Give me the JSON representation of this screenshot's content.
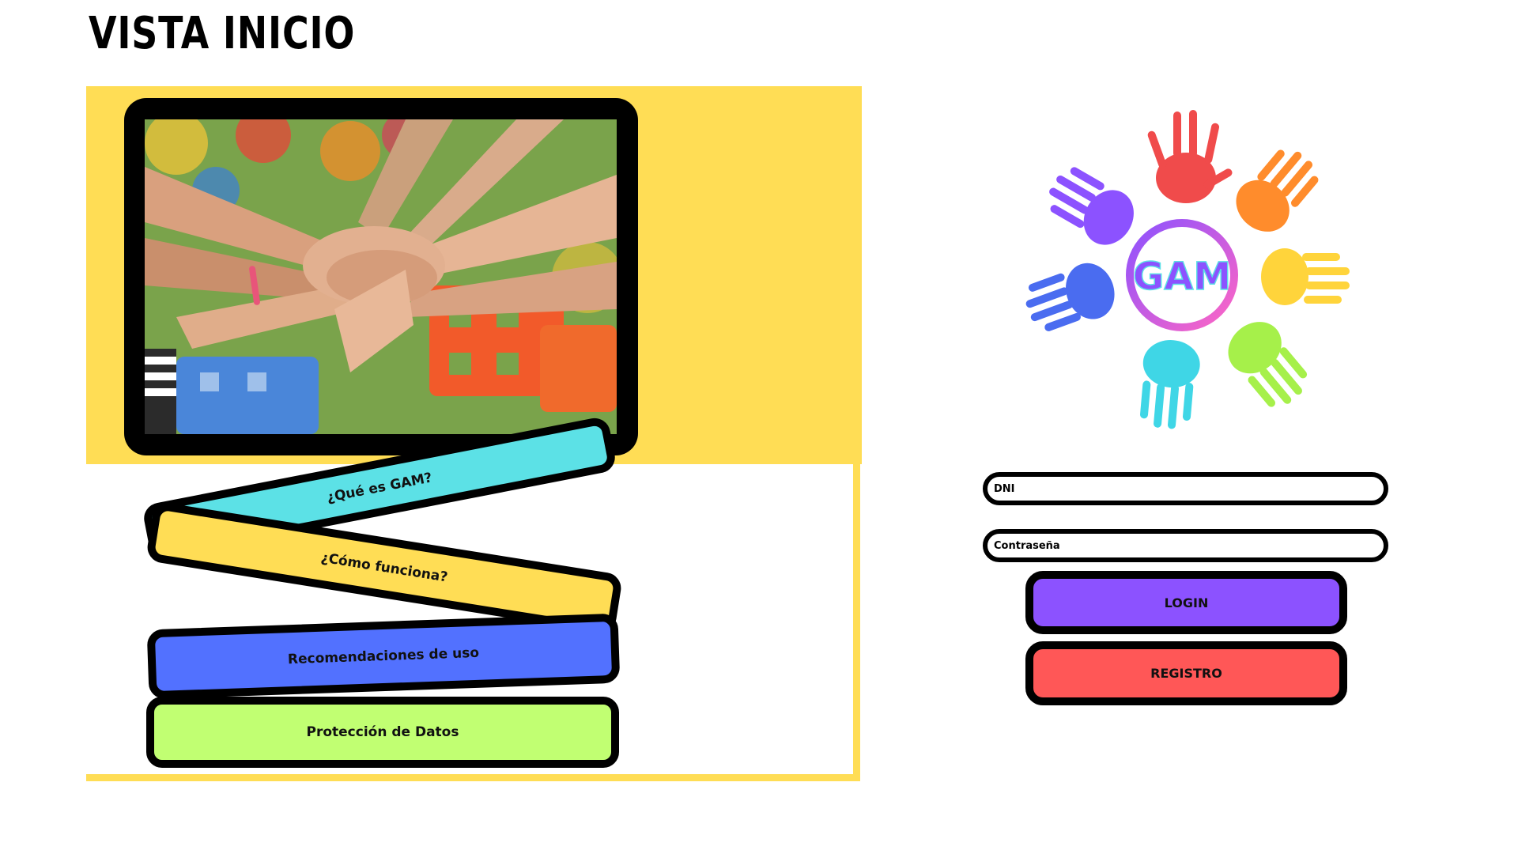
{
  "page": {
    "title": "VISTA INICIO"
  },
  "menu": {
    "items": [
      {
        "label": "¿Qué es GAM?",
        "color": "#5ce1e6"
      },
      {
        "label": "¿Cómo funciona?",
        "color": "#ffdd55"
      },
      {
        "label": "Recomendaciones de uso",
        "color": "#5271ff"
      },
      {
        "label": "Protección de Datos",
        "color": "#c1ff72"
      }
    ]
  },
  "logo": {
    "text": "GAM"
  },
  "login": {
    "dni_placeholder": "DNI",
    "password_placeholder": "Contraseña",
    "login_label": "LOGIN",
    "register_label": "REGISTRO"
  },
  "colors": {
    "panel_yellow": "#ffdd55",
    "login_purple": "#8c52ff",
    "register_red": "#ff5757",
    "logo_ring": "#8c52ff"
  }
}
